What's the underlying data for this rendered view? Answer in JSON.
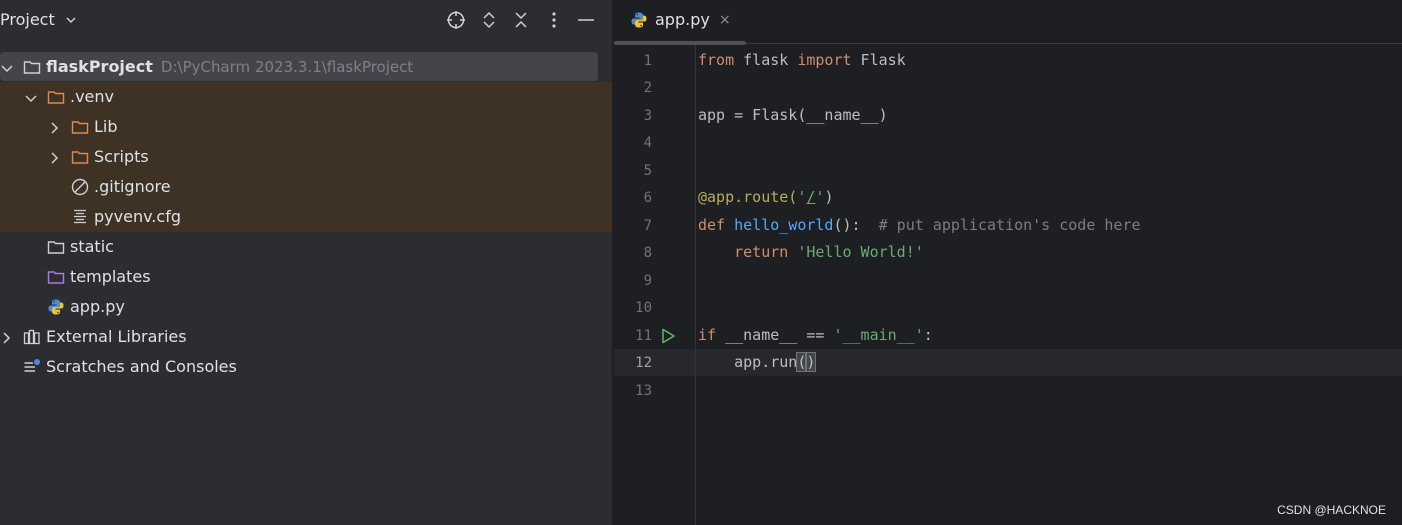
{
  "project_panel": {
    "title": "Project",
    "tree": {
      "root": {
        "label": "flaskProject",
        "path": "D:\\PyCharm 2023.3.1\\flaskProject"
      },
      "venv": ".venv",
      "lib": "Lib",
      "scripts": "Scripts",
      "gitignore": ".gitignore",
      "pyvenv": "pyvenv.cfg",
      "static": "static",
      "templates": "templates",
      "app": "app.py",
      "external": "External Libraries",
      "scratches": "Scratches and Consoles"
    }
  },
  "editor": {
    "tab": {
      "label": "app.py",
      "close": "×"
    },
    "line_numbers": [
      "1",
      "2",
      "3",
      "4",
      "5",
      "6",
      "7",
      "8",
      "9",
      "10",
      "11",
      "12",
      "13"
    ],
    "current_line": "12",
    "code": {
      "l1": {
        "kw_from": "from",
        "mod": " flask ",
        "kw_import": "import",
        "cls": " Flask"
      },
      "l3": {
        "text": "app = Flask(__name__)"
      },
      "l6": {
        "dec": "@app.route(",
        "str_q1": "'",
        "str_slash": "/",
        "str_q2": "'",
        "close": ")"
      },
      "l7": {
        "kw_def": "def",
        "sp": " ",
        "fn": "hello_world",
        "rest": "():  ",
        "cmt": "# put application's code here"
      },
      "l8": {
        "indent": "    ",
        "kw_return": "return",
        "sp": " ",
        "str": "'Hello World!'"
      },
      "l11": {
        "kw_if": "if",
        "mid": " __name__ == ",
        "str": "'__main__'",
        "colon": ":"
      },
      "l12": {
        "indent": "    ",
        "call": "app.run",
        "paren_open": "(",
        "paren_close": ")"
      }
    }
  },
  "watermark": "CSDN @HACKNOE",
  "colors": {
    "panel_bg": "#2b2d30",
    "editor_bg": "#1e1f22",
    "excluded_bg": "#3e3224",
    "keyword": "#cf8e6d",
    "string": "#6aab73",
    "function": "#56a8f5",
    "decorator": "#b3ae60"
  },
  "icons": {
    "project_chevron": "chevron-down-icon",
    "locate": "crosshair-icon",
    "expand": "expand-all-icon",
    "collapse": "collapse-all-icon",
    "options": "kebab-menu-icon",
    "hide": "minimize-icon",
    "folder": "folder-icon",
    "python_file": "python-icon",
    "gitignore": "ignore-file-icon",
    "config": "text-file-icon",
    "libraries": "libraries-icon",
    "scratches": "scratches-icon",
    "run": "run-icon"
  }
}
